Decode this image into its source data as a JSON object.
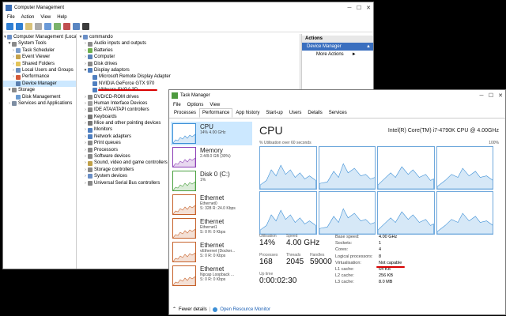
{
  "cm": {
    "title": "Computer Management",
    "menu": [
      "File",
      "Action",
      "View",
      "Help"
    ],
    "tree": [
      {
        "label": "Computer Management (Local"
      },
      {
        "label": "System Tools"
      },
      {
        "label": "Task Scheduler"
      },
      {
        "label": "Event Viewer"
      },
      {
        "label": "Shared Folders"
      },
      {
        "label": "Local Users and Groups"
      },
      {
        "label": "Performance"
      },
      {
        "label": "Device Manager"
      },
      {
        "label": "Storage"
      },
      {
        "label": "Disk Management"
      },
      {
        "label": "Services and Applications"
      }
    ],
    "devices": [
      {
        "label": "commando"
      },
      {
        "label": "Audio inputs and outputs"
      },
      {
        "label": "Batteries"
      },
      {
        "label": "Computer"
      },
      {
        "label": "Disk drives"
      },
      {
        "label": "Display adaptors"
      },
      {
        "label": "Microsoft Remote Display Adapter"
      },
      {
        "label": "NVIDIA GeForce GTX 970"
      },
      {
        "label": "VMware SVGA 3D"
      },
      {
        "label": "DVD/CD-ROM drives"
      },
      {
        "label": "Human Interface Devices"
      },
      {
        "label": "IDE ATA/ATAPI controllers"
      },
      {
        "label": "Keyboards"
      },
      {
        "label": "Mice and other pointing devices"
      },
      {
        "label": "Monitors"
      },
      {
        "label": "Network adapters"
      },
      {
        "label": "Print queues"
      },
      {
        "label": "Processors"
      },
      {
        "label": "Software devices"
      },
      {
        "label": "Sound, video and game controllers"
      },
      {
        "label": "Storage controllers"
      },
      {
        "label": "System devices"
      },
      {
        "label": "Universal Serial Bus controllers"
      }
    ],
    "actions": {
      "header": "Actions",
      "selected": "Device Manager",
      "item": "More Actions"
    }
  },
  "tm": {
    "title": "Task Manager",
    "menu": [
      "File",
      "Options",
      "View"
    ],
    "tabs": [
      "Processes",
      "Performance",
      "App history",
      "Start-up",
      "Users",
      "Details",
      "Services"
    ],
    "side": [
      {
        "title": "CPU",
        "sub": "14%  4.00 GHz",
        "color": "#3c8fd6"
      },
      {
        "title": "Memory",
        "sub": "2.4/8.0 GB (30%)",
        "color": "#8b3db5"
      },
      {
        "title": "Disk 0 (C:)",
        "sub": "1%",
        "color": "#4aa03f"
      },
      {
        "title": "Ethernet",
        "sub": "Ethernet0",
        "sub2": "S: 328  R: 24.0 Kbps",
        "color": "#c6622b"
      },
      {
        "title": "Ethernet",
        "sub": "Ethernet1",
        "sub2": "S: 0  R: 0 Kbps",
        "color": "#c6622b"
      },
      {
        "title": "Ethernet",
        "sub": "vEthernet (Docker...",
        "sub2": "S: 0  R: 0 Kbps",
        "color": "#c6622b"
      },
      {
        "title": "Ethernet",
        "sub": "Npcap Loopback ...",
        "sub2": "S: 0  R: 0 Kbps",
        "color": "#c6622b"
      }
    ],
    "cpu_title": "CPU",
    "cpu_model": "Intel(R) Core(TM) i7-4790K CPU @ 4.00GHz",
    "util_label": "% Utilisation over 60 seconds",
    "util_max": "100%",
    "stats": {
      "utilisation_lbl": "Utilisation",
      "utilisation": "14%",
      "speed_lbl": "Speed",
      "speed": "4.00 GHz",
      "processes_lbl": "Processes",
      "processes": "168",
      "threads_lbl": "Threads",
      "threads": "2045",
      "handles_lbl": "Handles",
      "handles": "59000",
      "uptime_lbl": "Up time",
      "uptime": "0:00:02:30"
    },
    "specs": [
      {
        "k": "Base speed:",
        "v": "4.00 GHz"
      },
      {
        "k": "Sockets:",
        "v": "1"
      },
      {
        "k": "Cores:",
        "v": "4"
      },
      {
        "k": "Logical processors:",
        "v": "8"
      },
      {
        "k": "Virtualisation:",
        "v": "Not capable"
      },
      {
        "k": "L1 cache:",
        "v": "64 KB"
      },
      {
        "k": "L2 cache:",
        "v": "256 KB"
      },
      {
        "k": "L3 cache:",
        "v": "8.0 MB"
      }
    ],
    "fewer": "Fewer details",
    "monitor": "Open Resource Monitor"
  },
  "accent": "#d80000"
}
